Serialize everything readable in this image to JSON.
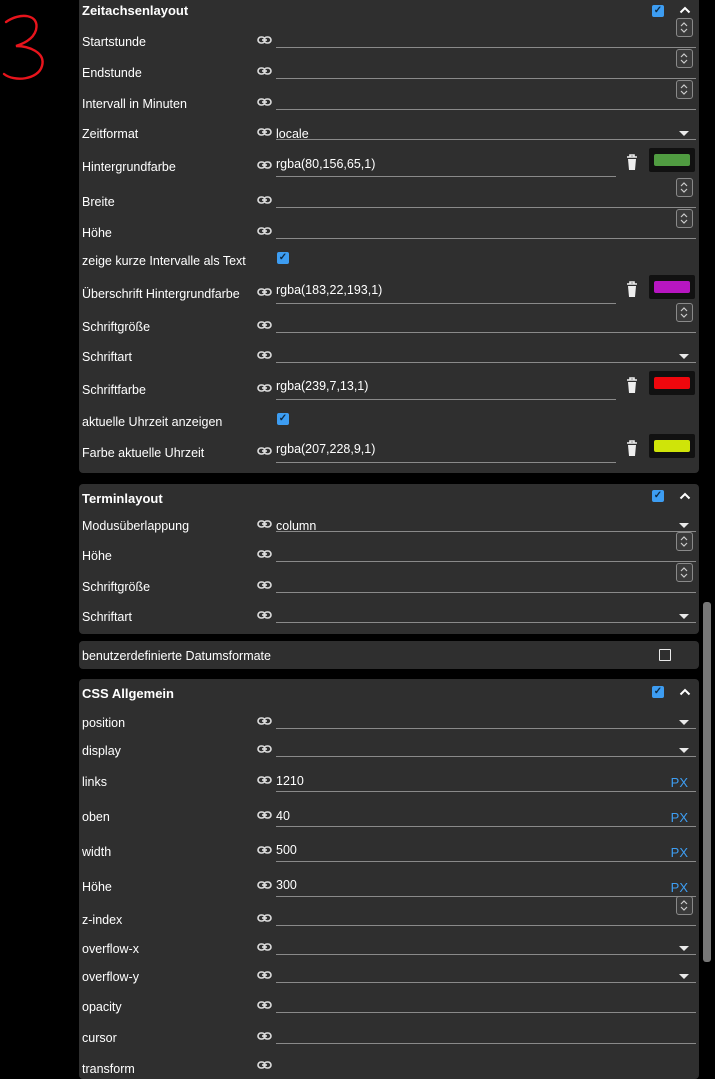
{
  "panels": {
    "zeitachse": {
      "title": "Zeitachsenlayout",
      "rows": {
        "startstunde": {
          "label": "Startstunde"
        },
        "endstunde": {
          "label": "Endstunde"
        },
        "intervall": {
          "label": "Intervall in Minuten"
        },
        "zeitformat": {
          "label": "Zeitformat",
          "value": "locale"
        },
        "hintergrundfarbe": {
          "label": "Hintergrundfarbe",
          "value": "rgba(80,156,65,1)",
          "color": "#509c41"
        },
        "breite": {
          "label": "Breite"
        },
        "hoehe": {
          "label": "Höhe"
        },
        "kurze_intervalle": {
          "label": "zeige kurze Intervalle als Text",
          "checked": true
        },
        "ueberschrift_hg": {
          "label": "Überschrift Hintergrundfarbe",
          "value": "rgba(183,22,193,1)",
          "color": "#b716c1"
        },
        "schriftgroesse": {
          "label": "Schriftgröße"
        },
        "schriftart": {
          "label": "Schriftart"
        },
        "schriftfarbe": {
          "label": "Schriftfarbe",
          "value": "rgba(239,7,13,1)",
          "color": "#ef070d"
        },
        "uhrzeit_anzeigen": {
          "label": "aktuelle Uhrzeit anzeigen",
          "checked": true
        },
        "farbe_uhrzeit": {
          "label": "Farbe aktuelle Uhrzeit",
          "value": "rgba(207,228,9,1)",
          "color": "#cfe409"
        }
      }
    },
    "termin": {
      "title": "Terminlayout",
      "rows": {
        "modus": {
          "label": "Modusüberlappung",
          "value": "column"
        },
        "hoehe": {
          "label": "Höhe"
        },
        "schriftgroesse": {
          "label": "Schriftgröße"
        },
        "schriftart": {
          "label": "Schriftart"
        }
      }
    },
    "datumsformate": {
      "title": "benutzerdefinierte Datumsformate",
      "checked": false
    },
    "css": {
      "title": "CSS Allgemein",
      "unit": "PX",
      "rows": {
        "position": {
          "label": "position"
        },
        "display": {
          "label": "display"
        },
        "links": {
          "label": "links",
          "value": "1210"
        },
        "oben": {
          "label": "oben",
          "value": "40"
        },
        "width": {
          "label": "width",
          "value": "500"
        },
        "hoehe": {
          "label": "Höhe",
          "value": "300"
        },
        "zindex": {
          "label": "z-index"
        },
        "overflowx": {
          "label": "overflow-x"
        },
        "overflowy": {
          "label": "overflow-y"
        },
        "opacity": {
          "label": "opacity"
        },
        "cursor": {
          "label": "cursor"
        },
        "transform": {
          "label": "transform"
        }
      }
    }
  },
  "colors": {
    "accent": "#3d9df2",
    "panel": "#2f2f2f",
    "background": "#000000"
  },
  "annotation": "3"
}
